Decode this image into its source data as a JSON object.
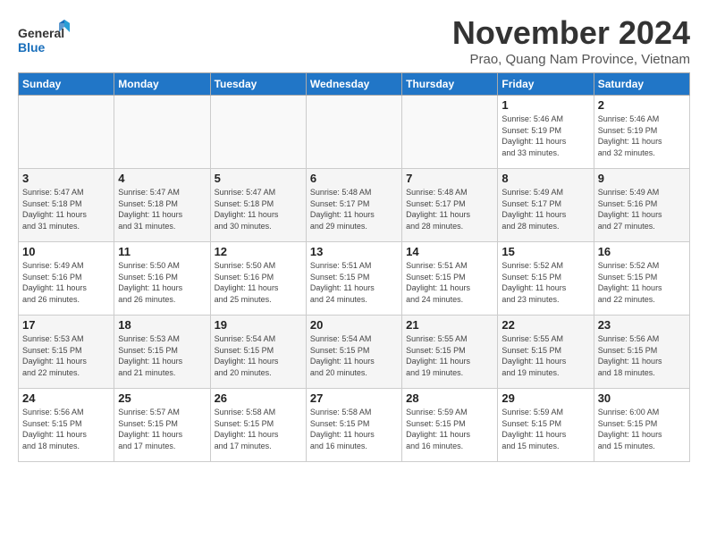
{
  "logo": {
    "line1": "General",
    "line2": "Blue"
  },
  "title": "November 2024",
  "subtitle": "Prao, Quang Nam Province, Vietnam",
  "days_header": [
    "Sunday",
    "Monday",
    "Tuesday",
    "Wednesday",
    "Thursday",
    "Friday",
    "Saturday"
  ],
  "weeks": [
    [
      {
        "day": "",
        "info": ""
      },
      {
        "day": "",
        "info": ""
      },
      {
        "day": "",
        "info": ""
      },
      {
        "day": "",
        "info": ""
      },
      {
        "day": "",
        "info": ""
      },
      {
        "day": "1",
        "info": "Sunrise: 5:46 AM\nSunset: 5:19 PM\nDaylight: 11 hours\nand 33 minutes."
      },
      {
        "day": "2",
        "info": "Sunrise: 5:46 AM\nSunset: 5:19 PM\nDaylight: 11 hours\nand 32 minutes."
      }
    ],
    [
      {
        "day": "3",
        "info": "Sunrise: 5:47 AM\nSunset: 5:18 PM\nDaylight: 11 hours\nand 31 minutes."
      },
      {
        "day": "4",
        "info": "Sunrise: 5:47 AM\nSunset: 5:18 PM\nDaylight: 11 hours\nand 31 minutes."
      },
      {
        "day": "5",
        "info": "Sunrise: 5:47 AM\nSunset: 5:18 PM\nDaylight: 11 hours\nand 30 minutes."
      },
      {
        "day": "6",
        "info": "Sunrise: 5:48 AM\nSunset: 5:17 PM\nDaylight: 11 hours\nand 29 minutes."
      },
      {
        "day": "7",
        "info": "Sunrise: 5:48 AM\nSunset: 5:17 PM\nDaylight: 11 hours\nand 28 minutes."
      },
      {
        "day": "8",
        "info": "Sunrise: 5:49 AM\nSunset: 5:17 PM\nDaylight: 11 hours\nand 28 minutes."
      },
      {
        "day": "9",
        "info": "Sunrise: 5:49 AM\nSunset: 5:16 PM\nDaylight: 11 hours\nand 27 minutes."
      }
    ],
    [
      {
        "day": "10",
        "info": "Sunrise: 5:49 AM\nSunset: 5:16 PM\nDaylight: 11 hours\nand 26 minutes."
      },
      {
        "day": "11",
        "info": "Sunrise: 5:50 AM\nSunset: 5:16 PM\nDaylight: 11 hours\nand 26 minutes."
      },
      {
        "day": "12",
        "info": "Sunrise: 5:50 AM\nSunset: 5:16 PM\nDaylight: 11 hours\nand 25 minutes."
      },
      {
        "day": "13",
        "info": "Sunrise: 5:51 AM\nSunset: 5:15 PM\nDaylight: 11 hours\nand 24 minutes."
      },
      {
        "day": "14",
        "info": "Sunrise: 5:51 AM\nSunset: 5:15 PM\nDaylight: 11 hours\nand 24 minutes."
      },
      {
        "day": "15",
        "info": "Sunrise: 5:52 AM\nSunset: 5:15 PM\nDaylight: 11 hours\nand 23 minutes."
      },
      {
        "day": "16",
        "info": "Sunrise: 5:52 AM\nSunset: 5:15 PM\nDaylight: 11 hours\nand 22 minutes."
      }
    ],
    [
      {
        "day": "17",
        "info": "Sunrise: 5:53 AM\nSunset: 5:15 PM\nDaylight: 11 hours\nand 22 minutes."
      },
      {
        "day": "18",
        "info": "Sunrise: 5:53 AM\nSunset: 5:15 PM\nDaylight: 11 hours\nand 21 minutes."
      },
      {
        "day": "19",
        "info": "Sunrise: 5:54 AM\nSunset: 5:15 PM\nDaylight: 11 hours\nand 20 minutes."
      },
      {
        "day": "20",
        "info": "Sunrise: 5:54 AM\nSunset: 5:15 PM\nDaylight: 11 hours\nand 20 minutes."
      },
      {
        "day": "21",
        "info": "Sunrise: 5:55 AM\nSunset: 5:15 PM\nDaylight: 11 hours\nand 19 minutes."
      },
      {
        "day": "22",
        "info": "Sunrise: 5:55 AM\nSunset: 5:15 PM\nDaylight: 11 hours\nand 19 minutes."
      },
      {
        "day": "23",
        "info": "Sunrise: 5:56 AM\nSunset: 5:15 PM\nDaylight: 11 hours\nand 18 minutes."
      }
    ],
    [
      {
        "day": "24",
        "info": "Sunrise: 5:56 AM\nSunset: 5:15 PM\nDaylight: 11 hours\nand 18 minutes."
      },
      {
        "day": "25",
        "info": "Sunrise: 5:57 AM\nSunset: 5:15 PM\nDaylight: 11 hours\nand 17 minutes."
      },
      {
        "day": "26",
        "info": "Sunrise: 5:58 AM\nSunset: 5:15 PM\nDaylight: 11 hours\nand 17 minutes."
      },
      {
        "day": "27",
        "info": "Sunrise: 5:58 AM\nSunset: 5:15 PM\nDaylight: 11 hours\nand 16 minutes."
      },
      {
        "day": "28",
        "info": "Sunrise: 5:59 AM\nSunset: 5:15 PM\nDaylight: 11 hours\nand 16 minutes."
      },
      {
        "day": "29",
        "info": "Sunrise: 5:59 AM\nSunset: 5:15 PM\nDaylight: 11 hours\nand 15 minutes."
      },
      {
        "day": "30",
        "info": "Sunrise: 6:00 AM\nSunset: 5:15 PM\nDaylight: 11 hours\nand 15 minutes."
      }
    ]
  ]
}
